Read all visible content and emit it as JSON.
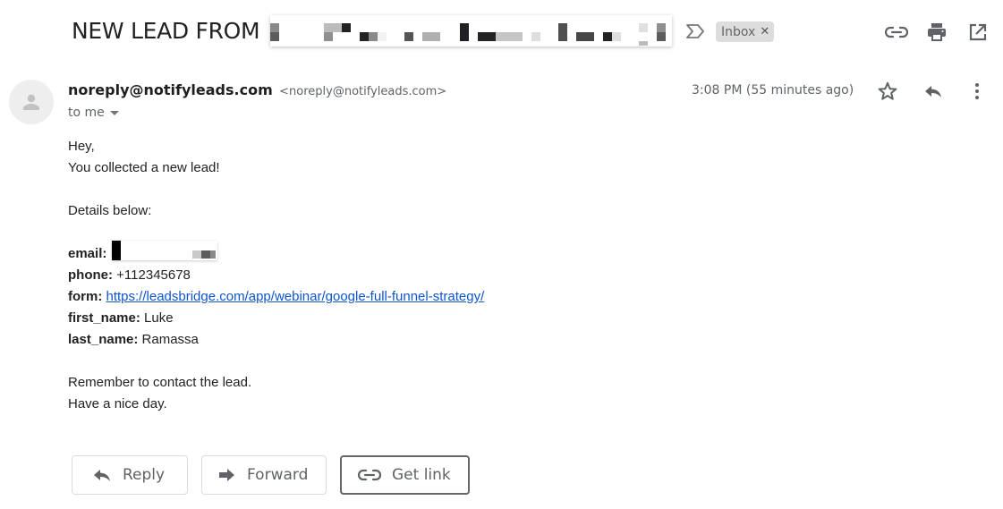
{
  "subject": {
    "text": "NEW LEAD FROM",
    "redacted": true
  },
  "labels": [
    {
      "name": "Inbox",
      "remove_icon": "close-icon"
    }
  ],
  "top_actions": [
    {
      "name": "link-icon",
      "tooltip": ""
    },
    {
      "name": "print-icon",
      "tooltip": ""
    },
    {
      "name": "open-in-new-window-icon",
      "tooltip": ""
    }
  ],
  "message": {
    "sender_name": "noreply@notifyleads.com",
    "sender_email": "<noreply@notifyleads.com>",
    "recipient": "to me",
    "timestamp": "3:08 PM (55 minutes ago)",
    "avatar_icon": "person-icon"
  },
  "body": {
    "greeting": "Hey,",
    "intro": "You collected a new lead!",
    "details_intro": "Details below:",
    "fields": [
      {
        "label": "email:",
        "value": "",
        "redacted": true
      },
      {
        "label": "phone:",
        "value": "+112345678"
      },
      {
        "label": "form:",
        "value": "https://leadsbridge.com/app/webinar/google-full-funnel-strategy/",
        "is_link": true
      },
      {
        "label": "first_name:",
        "value": "Luke"
      },
      {
        "label": "last_name:",
        "value": "Ramassa"
      }
    ],
    "closing_1": "Remember to contact the lead.",
    "closing_2": "Have a nice day."
  },
  "actions": {
    "reply": "Reply",
    "forward": "Forward",
    "get_link": "Get link"
  },
  "colors": {
    "link": "#1155cc",
    "icon": "#5f6368",
    "chip_bg": "#dddddd"
  }
}
